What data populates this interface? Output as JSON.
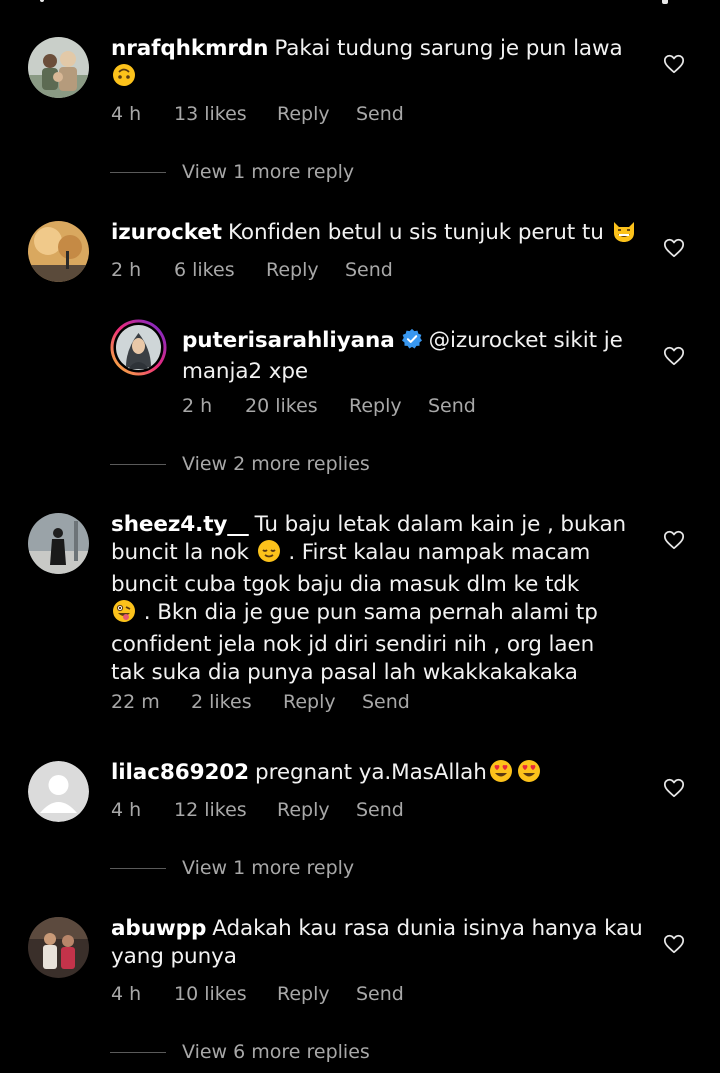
{
  "comments": [
    {
      "username": "nrafqhkmrdn",
      "text_line1": "Pakai tudung sarung je pun lawa",
      "emoji1": "upside-down-face",
      "time": "4 h",
      "likes": "13 likes",
      "reply": "Reply",
      "send": "Send",
      "view_more": "View 1 more reply"
    },
    {
      "username": "izurocket",
      "text_line1": "Konfiden betul u sis tunjuk perut tu",
      "emoji1": "grinning-cat",
      "time": "2 h",
      "likes": "6 likes",
      "reply": "Reply",
      "send": "Send"
    },
    {
      "username": "puterisarahliyana",
      "verified": "verified-badge-icon",
      "mention": "@izurocket",
      "text_line1": "sikit je",
      "text_line2": "manja2 xpe",
      "time": "2 h",
      "likes": "20 likes",
      "reply": "Reply",
      "send": "Send",
      "view_more": "View 2 more replies"
    },
    {
      "username": "sheez4.ty__",
      "text_line1": "Tu baju letak dalam kain je ,  bukan",
      "text_line2a": "buncit la nok",
      "emoji1": "relieved-face",
      "text_line2b": ". First kalau nampak macam",
      "text_line3": "buncit cuba tgok baju dia masuk dlm ke tdk",
      "emoji2": "zany-face",
      "text_line4": ". Bkn dia je gue pun sama pernah alami tp",
      "text_line5": "confident jela nok jd diri sendiri nih , org laen",
      "text_line6": "tak suka dia punya pasal lah  wkakkakakaka",
      "time": "22 m",
      "likes": "2 likes",
      "reply": "Reply",
      "send": "Send"
    },
    {
      "username": "lilac869202",
      "text_line1": "pregnant ya.MasAllah",
      "emoji1": "heart-eyes",
      "time": "4 h",
      "likes": "12 likes",
      "reply": "Reply",
      "send": "Send",
      "view_more": "View 1 more reply"
    },
    {
      "username": "abuwpp",
      "text_line1": "Adakah kau rasa dunia isinya hanya kau",
      "text_line2": "yang punya",
      "time": "4 h",
      "likes": "10 likes",
      "reply": "Reply",
      "send": "Send",
      "view_more": "View 6 more replies"
    }
  ],
  "colors": {
    "background": "#000000",
    "text": "#f2f2f2",
    "secondary": "#a8a8a8",
    "verified": "#3897f0"
  }
}
